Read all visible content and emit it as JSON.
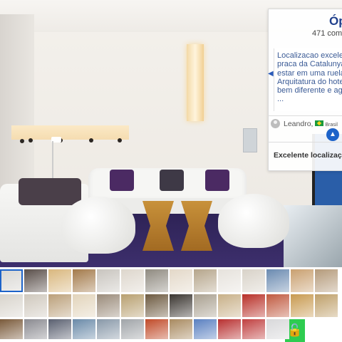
{
  "review": {
    "hotel_title": "Óp",
    "reviews_count": "471 come",
    "quote_lines": [
      "Localizacao excele",
      "praca da Catalunya",
      "estar em uma ruela",
      "Arquitatura do hote",
      "bem diferente e ag",
      "..."
    ],
    "reviewer": "Leandro,",
    "country": "Brasil",
    "next_heading": "Excelente localizaç"
  },
  "gallery": {
    "thumbnail_count": 42,
    "selected_index": 0,
    "thumb_colors": [
      "#d8d6d2",
      "#5a4f4a",
      "#d9b77e",
      "#a37a4a",
      "#c8c4be",
      "#ddd6cc",
      "#8f8a80",
      "#e3d8c8",
      "#b5a58b",
      "#e6e2dc",
      "#d8d2c8",
      "#6a8ab0",
      "#c9a070",
      "#b49a7a",
      "#d8d4cc",
      "#cfc8bd",
      "#bba07a",
      "#e2d4bb",
      "#9a8b7a",
      "#b8a070",
      "#6d5a40",
      "#3a3530",
      "#a9a090",
      "#c8b088",
      "#b83028",
      "#c05a40",
      "#c89a50",
      "#bfa06a",
      "#7a5a3a",
      "#8a8a90",
      "#5a6070",
      "#6a8aa8",
      "#8898a8",
      "#a0a4a8",
      "#c04a28",
      "#a88a60",
      "#5a80c0",
      "#b83030",
      "#c04040",
      "#d8d8da",
      "#e8e8e8",
      "#f0f0f0"
    ]
  },
  "lock_icon": "lock-icon"
}
